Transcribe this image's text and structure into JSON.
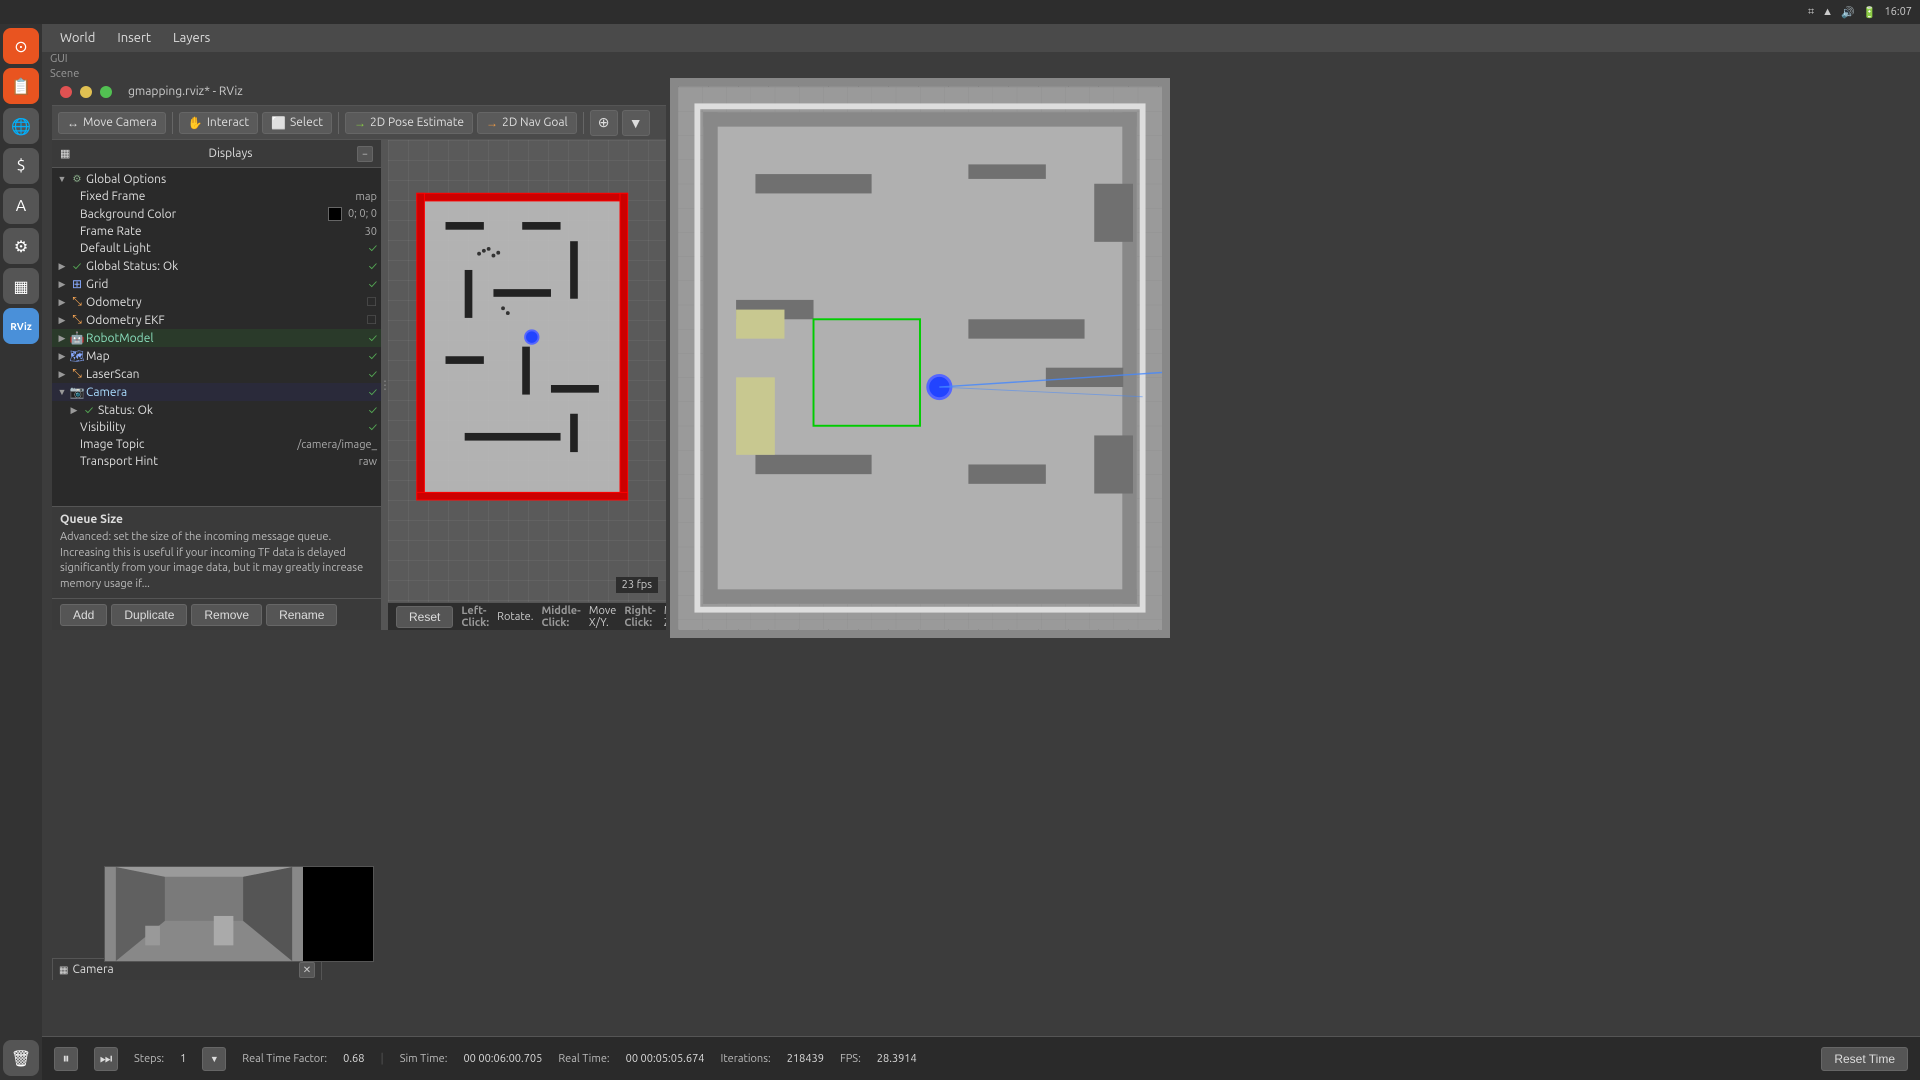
{
  "window_title": "gmapping.rviz* - RViz",
  "system_bar": {
    "time": "16:07",
    "icons": [
      "bluetooth",
      "network",
      "sound",
      "battery"
    ]
  },
  "menu": {
    "items": [
      "World",
      "Insert",
      "Layers"
    ]
  },
  "submenu": {
    "items": [
      "GUI",
      "Scene"
    ]
  },
  "rviz_window": {
    "title": "gmapping.rviz* - RViz",
    "toolbar": {
      "buttons": [
        "move_camera",
        "interact",
        "select",
        "2d_pose_estimate",
        "2d_nav_goal",
        "focus",
        "dropdown"
      ],
      "labels": [
        "Move Camera",
        "Interact",
        "Select",
        "2D Pose Estimate",
        "2D Nav Goal"
      ]
    }
  },
  "displays": {
    "header": "Displays",
    "items": [
      {
        "name": "Global Options",
        "level": 0,
        "expanded": true,
        "type": "folder",
        "children": [
          {
            "name": "Fixed Frame",
            "value": "map",
            "level": 1
          },
          {
            "name": "Background Color",
            "value": "0; 0; 0",
            "level": 1,
            "has_swatch": true
          },
          {
            "name": "Frame Rate",
            "value": "30",
            "level": 1
          },
          {
            "name": "Default Light",
            "value": "",
            "level": 1,
            "checked": true
          }
        ]
      },
      {
        "name": "Global Status: Ok",
        "level": 0,
        "checked": true,
        "type": "status"
      },
      {
        "name": "Grid",
        "level": 0,
        "checked": true,
        "type": "plugin"
      },
      {
        "name": "Odometry",
        "level": 0,
        "checked": false,
        "type": "plugin"
      },
      {
        "name": "Odometry EKF",
        "level": 0,
        "checked": false,
        "type": "plugin"
      },
      {
        "name": "RobotModel",
        "level": 0,
        "checked": true,
        "type": "plugin",
        "highlighted": true
      },
      {
        "name": "Map",
        "level": 0,
        "checked": true,
        "type": "plugin"
      },
      {
        "name": "LaserScan",
        "level": 0,
        "checked": true,
        "type": "plugin"
      },
      {
        "name": "Camera",
        "level": 0,
        "expanded": true,
        "checked": true,
        "type": "plugin",
        "highlighted": true,
        "children": [
          {
            "name": "Status: Ok",
            "level": 1,
            "checked": true
          },
          {
            "name": "Visibility",
            "level": 1,
            "checked": true
          },
          {
            "name": "Image Topic",
            "value": "/camera/image_",
            "level": 1
          },
          {
            "name": "Transport Hint",
            "value": "raw",
            "level": 1
          }
        ]
      }
    ]
  },
  "tooltip": {
    "title": "Queue Size",
    "text": "Advanced: set the size of the incoming message queue. Increasing this is useful if your incoming TF data is delayed significantly from your image data, but it may greatly increase memory usage if..."
  },
  "action_buttons": [
    "Add",
    "Duplicate",
    "Remove",
    "Rename"
  ],
  "camera_panel": {
    "title": "Camera"
  },
  "status_bar": {
    "hint": "Left-Click: Rotate. Middle-Click: Move X/Y. Right-Click: Move Z. Shift: More options.",
    "reset": "Reset",
    "fps": "23 fps"
  },
  "timeline": {
    "steps_label": "Steps:",
    "steps_value": "1",
    "real_time_factor_label": "Real Time Factor:",
    "real_time_factor_value": "0.68",
    "sim_time_label": "Sim Time:",
    "sim_time_value": "00 00:06:00.705",
    "real_time_label": "Real Time:",
    "real_time_value": "00 00:05:05.674",
    "iterations_label": "Iterations:",
    "iterations_value": "218439",
    "fps_label": "FPS:",
    "fps_value": "28.3914",
    "reset_button": "Reset Time"
  },
  "icons": {
    "close": "✕",
    "minimize": "−",
    "maximize": "□",
    "arrow_right": "▶",
    "arrow_down": "▼",
    "check": "✓",
    "folder": "📁",
    "pause": "⏸",
    "step": "⏭",
    "camera": "📷",
    "gear": "⚙",
    "arrow": "➤"
  },
  "colors": {
    "accent": "#e95420",
    "bg_dark": "#2a2a2a",
    "bg_mid": "#3c3c3c",
    "bg_light": "#4a4a4a",
    "border": "#555555",
    "text_primary": "#dddddd",
    "text_secondary": "#aaaaaa",
    "map_bg": "#686868",
    "map_free": "#c8c8c8",
    "map_wall": "#222222",
    "map_wall_red": "#cc0000",
    "robot": "#2244ff",
    "laser": "#4488ff",
    "grid_green": "#00cc00"
  }
}
